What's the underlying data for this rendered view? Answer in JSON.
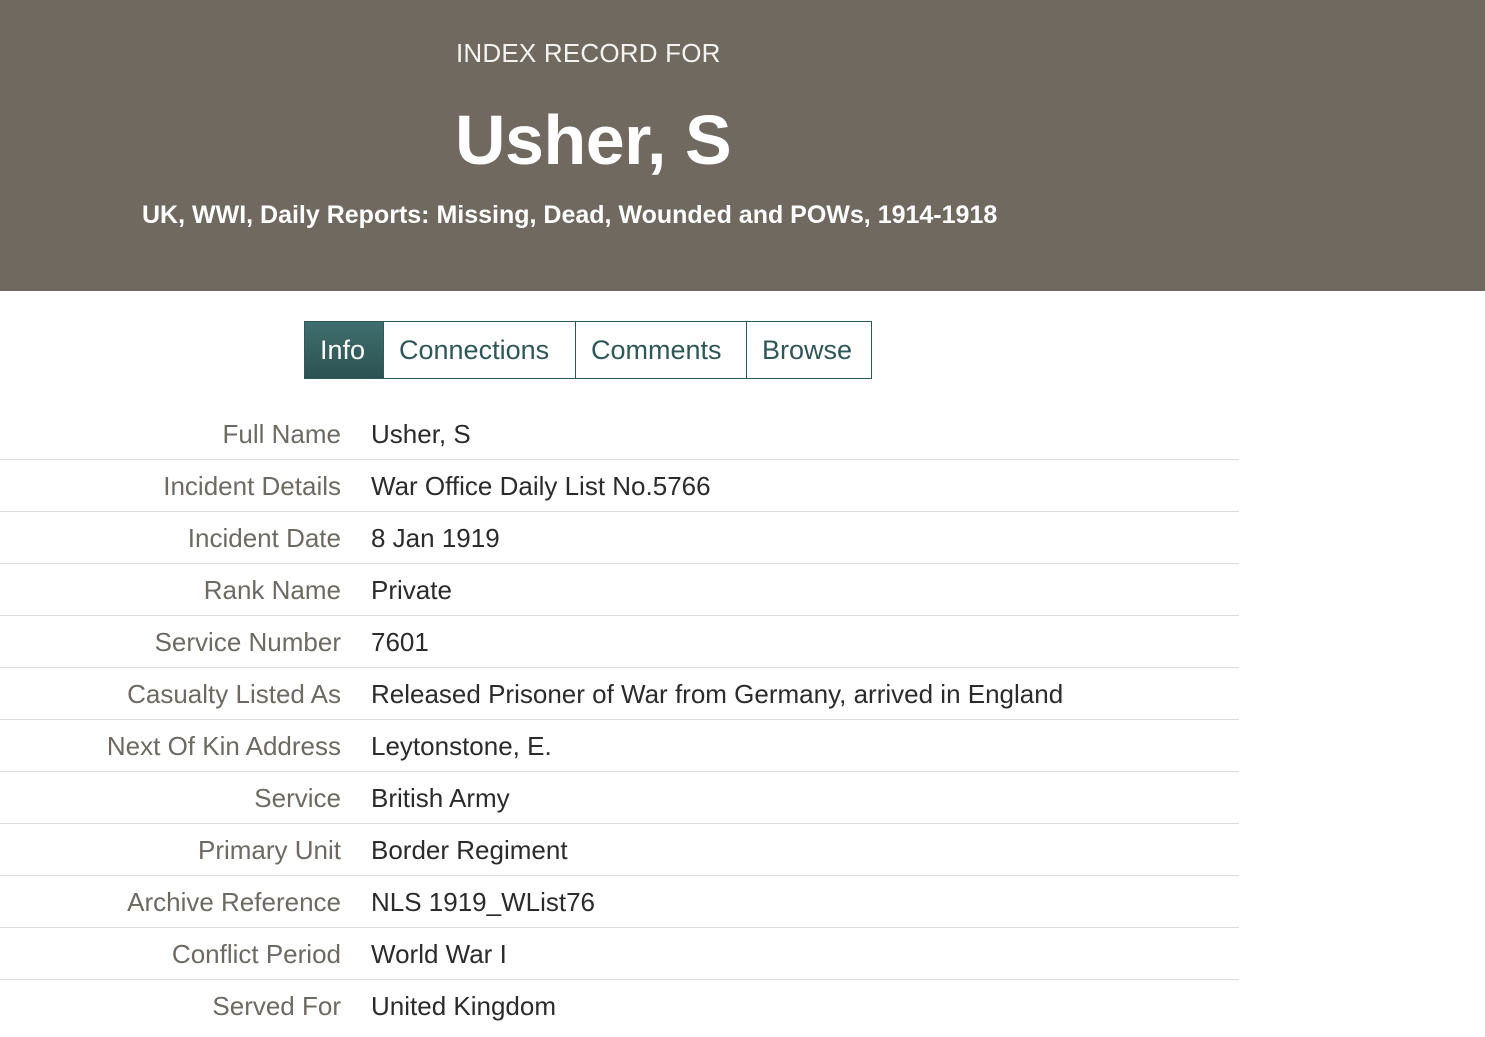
{
  "header": {
    "kicker": "INDEX RECORD FOR",
    "title": "Usher, S",
    "collection": "UK, WWI, Daily Reports: Missing, Dead, Wounded and POWs, 1914-1918"
  },
  "tabs": [
    {
      "label": "Info",
      "active": true
    },
    {
      "label": "Connections",
      "active": false
    },
    {
      "label": "Comments",
      "active": false
    },
    {
      "label": "Browse",
      "active": false
    }
  ],
  "details": [
    {
      "label": "Full Name",
      "value": "Usher, S"
    },
    {
      "label": "Incident Details",
      "value": "War Office Daily List No.5766"
    },
    {
      "label": "Incident Date",
      "value": "8 Jan 1919"
    },
    {
      "label": "Rank Name",
      "value": "Private"
    },
    {
      "label": "Service Number",
      "value": "7601"
    },
    {
      "label": "Casualty Listed As",
      "value": "Released Prisoner of War from Germany, arrived in England"
    },
    {
      "label": "Next Of Kin Address",
      "value": "Leytonstone, E."
    },
    {
      "label": "Service",
      "value": "British Army"
    },
    {
      "label": "Primary Unit",
      "value": "Border Regiment"
    },
    {
      "label": "Archive Reference",
      "value": "NLS 1919_WList76"
    },
    {
      "label": "Conflict Period",
      "value": "World War I"
    },
    {
      "label": "Served For",
      "value": "United Kingdom"
    }
  ],
  "colors": {
    "header_bg": "#70695f",
    "tab_accent": "#2f5a5a",
    "label_text": "#6c6a62"
  }
}
